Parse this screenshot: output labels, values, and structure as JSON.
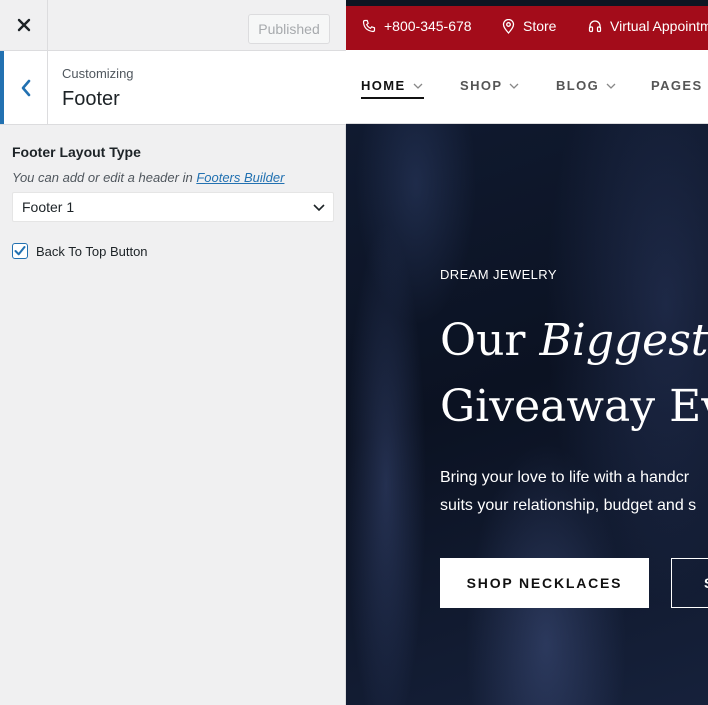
{
  "customizer": {
    "publish_label": "Published",
    "section_subtitle": "Customizing",
    "section_title": "Footer",
    "footer_layout": {
      "label": "Footer Layout Type",
      "description_prefix": "You can add or edit a header in ",
      "link_text": "Footers Builder",
      "selected": "Footer 1"
    },
    "back_to_top": {
      "label": "Back To Top Button",
      "checked": true
    }
  },
  "preview": {
    "topbar": {
      "phone": "+800-345-678",
      "store": "Store",
      "virtual": "Virtual Appointm"
    },
    "nav": {
      "items": [
        {
          "label": "HOME"
        },
        {
          "label": "SHOP"
        },
        {
          "label": "BLOG"
        },
        {
          "label": "PAGES"
        }
      ]
    },
    "hero": {
      "eyebrow": "DREAM JEWELRY",
      "title_line1_plain": "Our ",
      "title_line1_italic": "Biggest D",
      "title_line2": "Giveaway Ev",
      "desc_line1": "Bring your love to life with a handcr",
      "desc_line2": "suits your relationship, budget and s",
      "primary_button": "SHOP NECKLACES",
      "secondary_button": "S"
    },
    "colors": {
      "topbar": "#a30c1a",
      "accent": "#2271b1",
      "hero_bg": "#0e1522"
    }
  }
}
